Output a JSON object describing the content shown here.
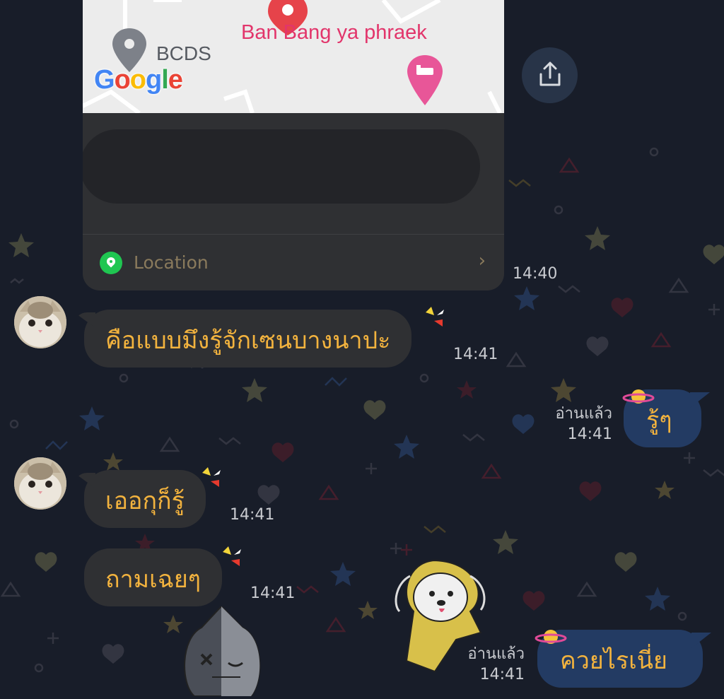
{
  "location_card": {
    "map_place": "Ban Bang ya phraek",
    "map_poi": "BCDS",
    "map_logo": "Google",
    "row_label": "Location",
    "timestamp": "14:40"
  },
  "messages": [
    {
      "side": "in",
      "text": "คือแบบมึงรู้จักเซนบางนาปะ",
      "time": "14:41",
      "has_avatar": true
    },
    {
      "side": "out",
      "text": "รู้ๆ",
      "read": "อ่านแล้ว",
      "time": "14:41"
    },
    {
      "side": "in",
      "text": "เออกุก็รู้",
      "time": "14:41",
      "has_avatar": true
    },
    {
      "side": "in",
      "text": "ถามเฉยๆ",
      "time": "14:41",
      "has_avatar": false
    },
    {
      "side": "out",
      "text": "ควยไรเนี่ย",
      "read": "อ่านแล้ว",
      "time": "14:41"
    }
  ],
  "colors": {
    "background": "#181d29",
    "bubble_in": "#2f3033",
    "bubble_out": "#233b63",
    "message_text": "#f3b33e",
    "location_pin": "#1fc651",
    "map_label": "#e2356b"
  },
  "icons": [
    "share-icon",
    "location-pin-icon",
    "chevron-right-icon",
    "hotel-pin-icon",
    "map-pin-icon",
    "sparkle-decoration-icon",
    "planet-decoration-icon"
  ]
}
